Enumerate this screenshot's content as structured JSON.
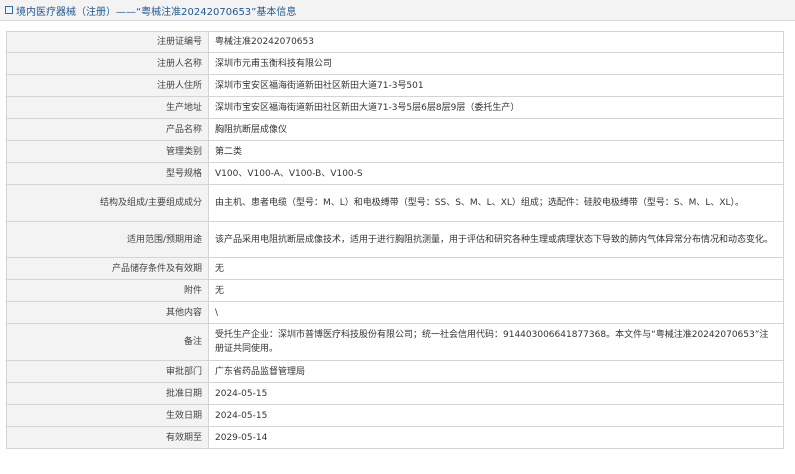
{
  "header": {
    "title": "境内医疗器械（注册）——“粤械注准20242070653”基本信息"
  },
  "rows": [
    {
      "label": "注册证编号",
      "value": "粤械注准20242070653"
    },
    {
      "label": "注册人名称",
      "value": "深圳市元甫玉衡科技有限公司"
    },
    {
      "label": "注册人住所",
      "value": "深圳市宝安区福海街道新田社区新田大道71-3号501"
    },
    {
      "label": "生产地址",
      "value": "深圳市宝安区福海街道新田社区新田大道71-3号5层6层8层9层（委托生产）"
    },
    {
      "label": "产品名称",
      "value": "胸阻抗断层成像仪"
    },
    {
      "label": "管理类别",
      "value": "第二类"
    },
    {
      "label": "型号规格",
      "value": "V100、V100-A、V100-B、V100-S"
    },
    {
      "label": "结构及组成/主要组成成分",
      "value": "由主机、患者电缆（型号：M、L）和电极缚带（型号：SS、S、M、L、XL）组成；选配件：硅胶电极缚带（型号：S、M、L、XL）。"
    },
    {
      "label": "适用范围/预期用途",
      "value": "该产品采用电阻抗断层成像技术，适用于进行胸阻抗测量，用于评估和研究各种生理或病理状态下导致的肺内气体异常分布情况和动态变化。"
    },
    {
      "label": "产品储存条件及有效期",
      "value": "无"
    },
    {
      "label": "附件",
      "value": "无"
    },
    {
      "label": "其他内容",
      "value": "\\"
    },
    {
      "label": "备注",
      "value": "受托生产企业：深圳市普博医疗科技股份有限公司；统一社会信用代码：914403006641877368。本文件与“粤械注准20242070653”注册证共同使用。"
    },
    {
      "label": "审批部门",
      "value": "广东省药品监督管理局"
    },
    {
      "label": "批准日期",
      "value": "2024-05-15"
    },
    {
      "label": "生效日期",
      "value": "2024-05-15"
    },
    {
      "label": "有效期至",
      "value": "2029-05-14"
    }
  ]
}
